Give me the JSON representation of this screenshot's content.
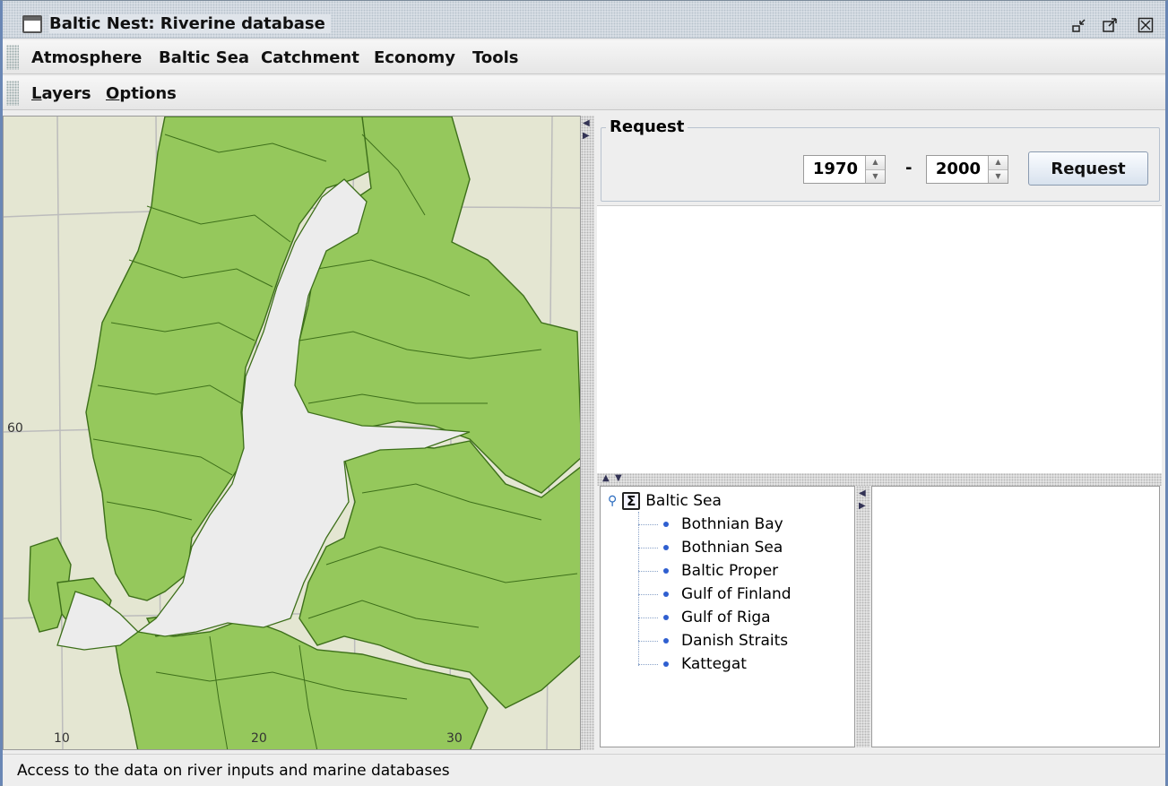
{
  "window": {
    "title": "Baltic Nest: Riverine database"
  },
  "menubar": {
    "items": [
      "Atmosphere",
      "Baltic Sea",
      "Catchment",
      "Economy",
      "Tools"
    ]
  },
  "toolbar": {
    "layers_mnemonic": "L",
    "layers_rest": "ayers",
    "options_mnemonic": "O",
    "options_rest": "ptions"
  },
  "map": {
    "lat_label": "60",
    "lon_labels": [
      "10",
      "20",
      "30"
    ],
    "colors": {
      "land": "#95c85c",
      "background": "#e4e6d2",
      "sea": "#ececec",
      "border": "#3d6f1a",
      "grid": "#bcbcbc"
    }
  },
  "request": {
    "title": "Request",
    "from_year": "1970",
    "separator": "-",
    "to_year": "2000",
    "button_label": "Request"
  },
  "tree": {
    "root": "Baltic Sea",
    "items": [
      "Bothnian Bay",
      "Bothnian Sea",
      "Baltic Proper",
      "Gulf of Finland",
      "Gulf of Riga",
      "Danish Straits",
      "Kattegat"
    ]
  },
  "status": {
    "text": "Access to the data on river inputs and marine databases"
  }
}
